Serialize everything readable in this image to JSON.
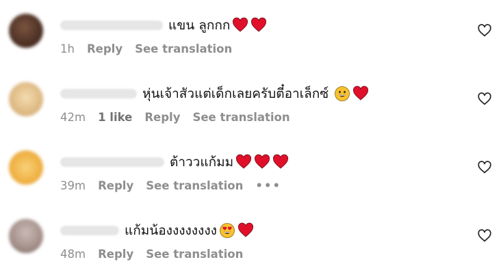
{
  "comments": [
    {
      "text": "แขน ลูกกก",
      "time": "1h",
      "likes": "",
      "reply_label": "Reply",
      "translation_label": "See translation",
      "avatar_color": "#5a3a2c",
      "username_width_hint": "blurred",
      "emojis": [
        "red-heart-icon",
        "red-heart-icon"
      ]
    },
    {
      "text": "หุ่นเจ้าสัวแต่เด็กเลยครับตี๋อาเล็กซ์",
      "time": "42m",
      "likes": "1 like",
      "reply_label": "Reply",
      "translation_label": "See translation",
      "avatar_color": "#e6c897",
      "emojis": [
        "grinning-face-icon",
        "red-heart-icon"
      ]
    },
    {
      "text": "ต้าววแก้มม",
      "time": "39m",
      "likes": "",
      "reply_label": "Reply",
      "translation_label": "See translation",
      "more": "•••",
      "avatar_color": "#f0b94a",
      "emojis": [
        "red-heart-icon",
        "red-heart-icon",
        "red-heart-icon"
      ]
    },
    {
      "text": "แก้มน้องงงงงงงง",
      "time": "48m",
      "likes": "",
      "reply_label": "Reply",
      "translation_label": "See translation",
      "avatar_color": "#b9a9a4",
      "emojis": [
        "heart-eyes-face-icon",
        "red-heart-icon"
      ]
    }
  ]
}
